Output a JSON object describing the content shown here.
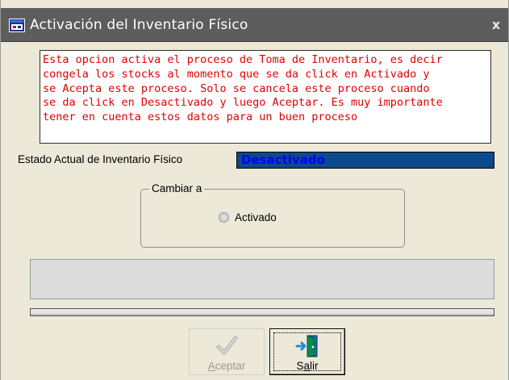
{
  "window": {
    "title": "Activación del Inventario Físico",
    "close_symbol": "x",
    "icon": "app-window-icon"
  },
  "info": {
    "lines": [
      "Esta opcion activa el proceso de Toma de Inventario, es decir",
      "congela los stocks al momento que se da click en Activado y",
      "se Acepta este proceso. Solo se cancela este proceso cuando",
      "se da click en Desactivado y luego Aceptar. Es muy importante",
      "tener en cuenta estos datos para un buen proceso"
    ],
    "text_color": "#e00000"
  },
  "estado": {
    "label": "Estado Actual de Inventario Físico",
    "value": "Desactivado",
    "value_background": "#0b4a8c",
    "value_color": "#0000ff"
  },
  "cambiar": {
    "legend": "Cambiar a",
    "option_label": "Activado",
    "option_selected": false
  },
  "buttons": {
    "aceptar": {
      "label": "Aceptar",
      "accesskey": "A",
      "enabled": false,
      "icon": "checkmark-icon"
    },
    "salir": {
      "label": "Salir",
      "accesskey": "a",
      "enabled": true,
      "icon": "exit-door-icon"
    }
  }
}
